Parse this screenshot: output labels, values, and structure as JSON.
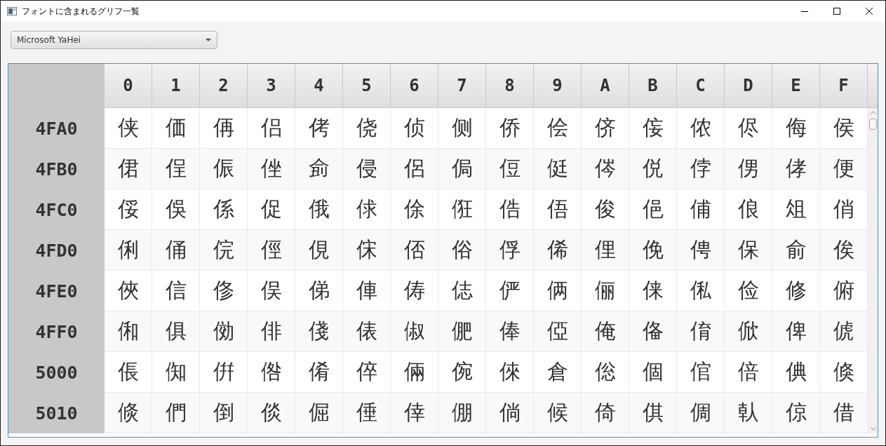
{
  "window": {
    "title": "フォントに含まれるグリフ一覧"
  },
  "font_select": {
    "value": "Microsoft YaHei"
  },
  "table": {
    "columns": [
      "0",
      "1",
      "2",
      "3",
      "4",
      "5",
      "6",
      "7",
      "8",
      "9",
      "A",
      "B",
      "C",
      "D",
      "E",
      "F"
    ],
    "rows": [
      {
        "label": "4FA0",
        "cells": [
          "侠",
          "価",
          "侢",
          "侣",
          "侤",
          "侥",
          "侦",
          "侧",
          "侨",
          "侩",
          "侪",
          "侫",
          "侬",
          "侭",
          "侮",
          "侯"
        ]
      },
      {
        "label": "4FB0",
        "cells": [
          "侰",
          "侱",
          "侲",
          "侳",
          "侴",
          "侵",
          "侶",
          "侷",
          "侸",
          "侹",
          "侺",
          "侻",
          "侼",
          "侽",
          "侾",
          "便"
        ]
      },
      {
        "label": "4FC0",
        "cells": [
          "俀",
          "俁",
          "係",
          "促",
          "俄",
          "俅",
          "俆",
          "俇",
          "俈",
          "俉",
          "俊",
          "俋",
          "俌",
          "俍",
          "俎",
          "俏"
        ]
      },
      {
        "label": "4FD0",
        "cells": [
          "俐",
          "俑",
          "俒",
          "俓",
          "俔",
          "俕",
          "俖",
          "俗",
          "俘",
          "俙",
          "俚",
          "俛",
          "俜",
          "保",
          "俞",
          "俟"
        ]
      },
      {
        "label": "4FE0",
        "cells": [
          "俠",
          "信",
          "俢",
          "俣",
          "俤",
          "俥",
          "俦",
          "俧",
          "俨",
          "俩",
          "俪",
          "俫",
          "俬",
          "俭",
          "修",
          "俯"
        ]
      },
      {
        "label": "4FF0",
        "cells": [
          "俰",
          "俱",
          "俲",
          "俳",
          "俴",
          "俵",
          "俶",
          "俷",
          "俸",
          "俹",
          "俺",
          "俻",
          "俼",
          "俽",
          "俾",
          "俿"
        ]
      },
      {
        "label": "5000",
        "cells": [
          "倀",
          "倁",
          "倂",
          "倃",
          "倄",
          "倅",
          "倆",
          "倇",
          "倈",
          "倉",
          "倊",
          "個",
          "倌",
          "倍",
          "倎",
          "倏"
        ]
      },
      {
        "label": "5010",
        "cells": [
          "倐",
          "們",
          "倒",
          "倓",
          "倔",
          "倕",
          "倖",
          "倗",
          "倘",
          "候",
          "倚",
          "倛",
          "倜",
          "倝",
          "倞",
          "借"
        ]
      }
    ]
  }
}
